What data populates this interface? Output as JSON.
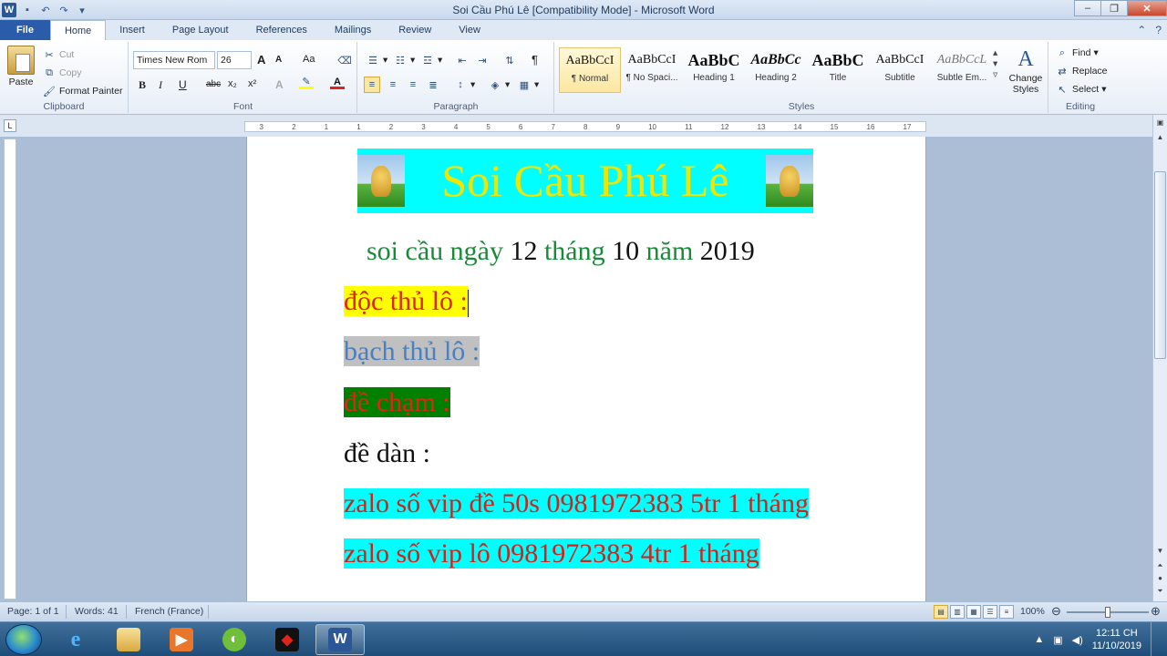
{
  "window": {
    "title": "Soi Cầu Phú Lê [Compatibility Mode]  -  Microsoft Word",
    "app_logo": "W"
  },
  "tabs": [
    "File",
    "Home",
    "Insert",
    "Page Layout",
    "References",
    "Mailings",
    "Review",
    "View"
  ],
  "clipboard": {
    "paste": "Paste",
    "cut": "Cut",
    "copy": "Copy",
    "format_painter": "Format Painter",
    "label": "Clipboard"
  },
  "font": {
    "name": "Times New Rom",
    "size": "26",
    "grow": "A",
    "shrink": "A",
    "change_case": "Aa",
    "bold": "B",
    "italic": "I",
    "underline": "U",
    "strike": "abc",
    "subscript": "x₂",
    "superscript": "x²",
    "label": "Font"
  },
  "paragraph": {
    "label": "Paragraph",
    "pilcrow": "¶"
  },
  "styles": {
    "label": "Styles",
    "items": [
      {
        "sample": "AaBbCcI",
        "name": "¶ Normal"
      },
      {
        "sample": "AaBbCcI",
        "name": "¶ No Spaci..."
      },
      {
        "sample": "AaBbC",
        "name": "Heading 1"
      },
      {
        "sample": "AaBbCc",
        "name": "Heading 2"
      },
      {
        "sample": "AaBbC",
        "name": "Title"
      },
      {
        "sample": "AaBbCcI",
        "name": "Subtitle"
      },
      {
        "sample": "AaBbCcL",
        "name": "Subtle Em..."
      }
    ],
    "change_styles": "Change Styles"
  },
  "editing": {
    "label": "Editing",
    "find": "Find",
    "replace": "Replace",
    "select": "Select"
  },
  "ruler": {
    "marks": [
      "3",
      "2",
      "1",
      "1",
      "2",
      "3",
      "4",
      "5",
      "6",
      "7",
      "8",
      "9",
      "10",
      "11",
      "12",
      "13",
      "14",
      "15",
      "16",
      "17"
    ]
  },
  "document": {
    "banner": "Soi Cầu Phú Lê",
    "date_line": {
      "p1": "soi cầu ngày ",
      "day": "12",
      "p2": " tháng ",
      "month": "10",
      "p3": " năm ",
      "year": "2019"
    },
    "lines": [
      "độc thủ lô :",
      "bạch thủ lô :",
      "đề chạm :",
      "đề dàn :",
      "zalo số vip đề 50s 0981972383 5tr 1 tháng",
      "zalo số vip lô 0981972383 4tr 1 tháng"
    ]
  },
  "status": {
    "page": "Page: 1 of 1",
    "words": "Words: 41",
    "language": "French (France)",
    "zoom": "100%"
  },
  "taskbar": {
    "time": "12:11 CH",
    "date": "11/10/2019"
  },
  "colors": {
    "banner_bg": "#00ffff",
    "banner_text": "#f4e500",
    "green_text": "#1a8a3a",
    "red_text": "#e2231a"
  }
}
